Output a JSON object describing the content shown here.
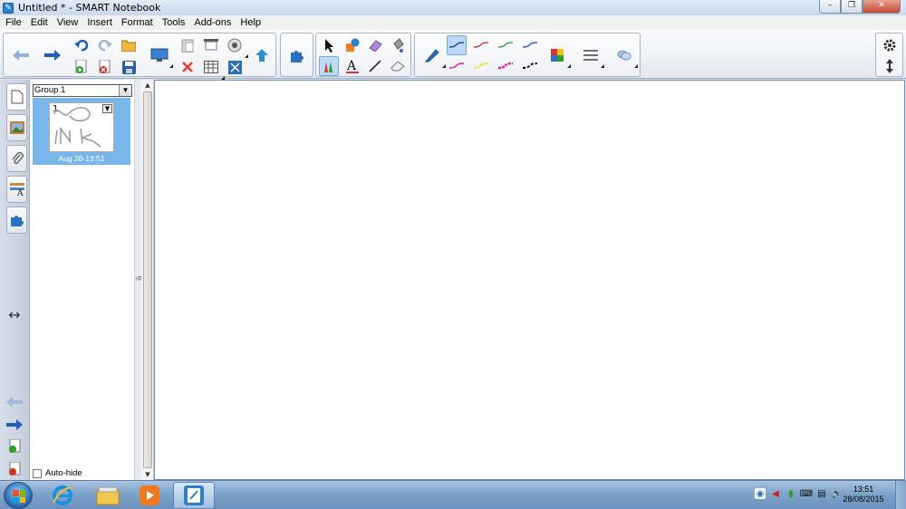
{
  "window": {
    "title": "Untitled * - SMART Notebook",
    "minimize": "–",
    "restore": "❐",
    "close": "✕"
  },
  "menu": [
    "File",
    "Edit",
    "View",
    "Insert",
    "Format",
    "Tools",
    "Add-ons",
    "Help"
  ],
  "toolbar": {
    "icons": [
      "back-arrow-icon",
      "forward-arrow-icon",
      "undo-icon",
      "redo-icon",
      "add-page-icon",
      "delete-page-icon",
      "open-file-icon",
      "save-icon",
      "screen-display-icon",
      "paste-icon",
      "delete-icon",
      "screen-shade-icon",
      "table-icon",
      "full-screen-icon",
      "capture-icon",
      "document-camera-icon",
      "addons-icon",
      "select-icon",
      "pens-icon",
      "shapes-icon",
      "text-icon",
      "eraser-icon",
      "lines-icon",
      "magic-pen-icon",
      "fill-icon",
      "pen-icon",
      "color-palette-icon",
      "properties-icon",
      "link-icon",
      "settings-gear-icon",
      "move-toolbar-icon"
    ],
    "pen_colors": {
      "row1": [
        "#0d4ea0",
        "#e02020",
        "#20a020",
        "#2040e0"
      ],
      "row2": [
        "#d020c0",
        "#f0e020",
        "#e020b0",
        "#101010"
      ]
    }
  },
  "sidebar": {
    "tabs": [
      "page-sorter-icon",
      "gallery-icon",
      "attachments-icon",
      "properties-icon",
      "addons-icon"
    ],
    "resize_glyph": "↔"
  },
  "sorter": {
    "group": "Group 1",
    "pages": [
      {
        "number": "1",
        "date": "Aug 28-13:51"
      }
    ],
    "auto_hide": "Auto-hide"
  },
  "taskbar": {
    "apps": [
      "internet-explorer-icon",
      "file-explorer-icon",
      "media-player-icon",
      "smart-notebook-icon"
    ],
    "time": "13:51",
    "date": "28/08/2015"
  }
}
